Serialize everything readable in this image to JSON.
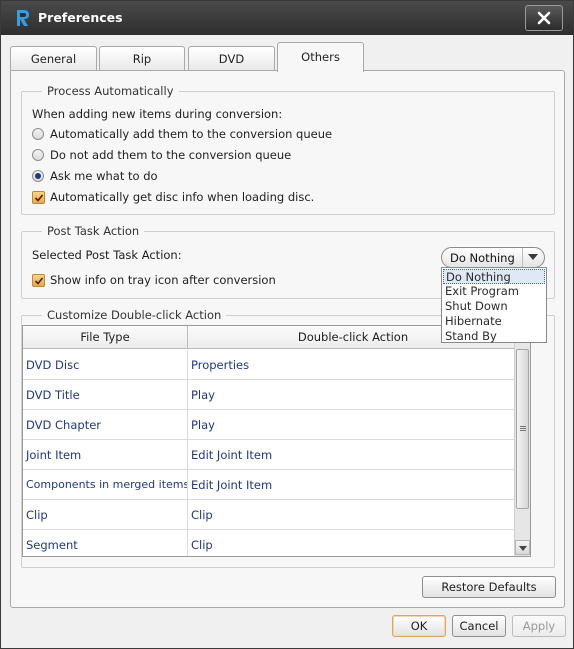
{
  "window": {
    "title": "Preferences"
  },
  "tabs": [
    {
      "label": "General",
      "active": false
    },
    {
      "label": "Rip",
      "active": false
    },
    {
      "label": "DVD",
      "active": false
    },
    {
      "label": "Others",
      "active": true
    }
  ],
  "process": {
    "legend": "Process Automatically",
    "intro": "When adding new items during conversion:",
    "options": [
      {
        "label": "Automatically add them to the conversion queue",
        "checked": false
      },
      {
        "label": "Do not add them to the conversion queue",
        "checked": false
      },
      {
        "label": "Ask me what to do",
        "checked": true
      }
    ],
    "disc_info_label": "Automatically get disc info when loading disc.",
    "disc_info_checked": true
  },
  "post_task": {
    "legend": "Post Task Action",
    "selected_label": "Selected Post Task Action:",
    "value": "Do Nothing",
    "options": [
      "Do Nothing",
      "Exit Program",
      "Shut Down",
      "Hibernate",
      "Stand By"
    ],
    "tray_label": "Show info on tray icon after conversion",
    "tray_checked": true
  },
  "double_click": {
    "legend": "Customize Double-click Action",
    "headers": [
      "File Type",
      "Double-click Action"
    ],
    "rows": [
      {
        "type": "DVD Disc",
        "action": "Properties"
      },
      {
        "type": "DVD Title",
        "action": "Play"
      },
      {
        "type": "DVD Chapter",
        "action": "Play"
      },
      {
        "type": "Joint Item",
        "action": "Edit Joint Item"
      },
      {
        "type": "Components in merged items",
        "action": "Edit Joint Item"
      },
      {
        "type": "Clip",
        "action": "Clip"
      },
      {
        "type": "Segment",
        "action": "Clip"
      }
    ]
  },
  "buttons": {
    "restore": "Restore Defaults",
    "ok": "OK",
    "cancel": "Cancel",
    "apply": "Apply"
  },
  "colors": {
    "titlebar": "#2e2e2e",
    "link_text": "#23387a",
    "checkbox": "#f3a63b",
    "ok_border": "#e2a35a"
  },
  "icons": [
    "app-logo-icon",
    "close-icon",
    "checkmark-icon",
    "dropdown-arrow-icon",
    "scroll-up-icon",
    "scroll-down-icon"
  ]
}
